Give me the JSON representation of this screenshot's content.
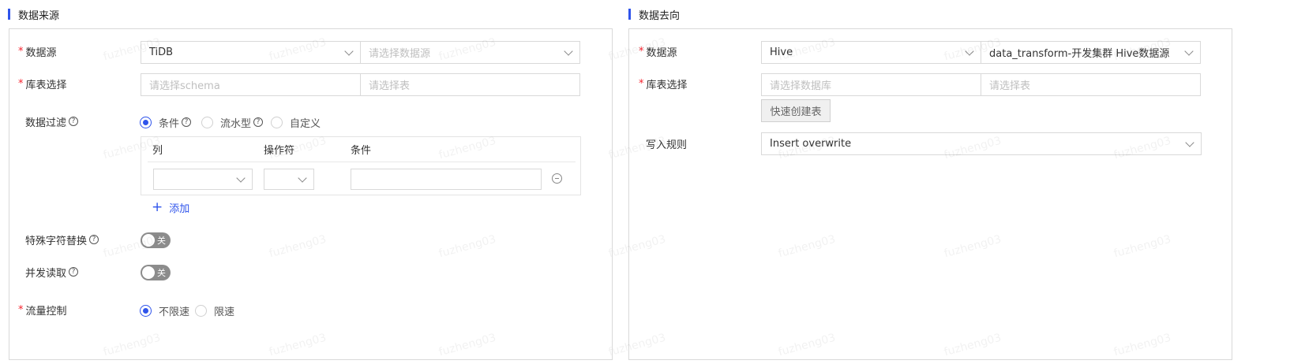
{
  "source": {
    "title": "数据来源",
    "datasource_label": "数据源",
    "datasource_type": "TiDB",
    "datasource_placeholder": "请选择数据源",
    "table_label": "库表选择",
    "schema_placeholder": "请选择schema",
    "table_placeholder": "请选择表",
    "filter_label": "数据过滤",
    "filter_options": [
      "条件",
      "流水型",
      "自定义"
    ],
    "filter_selected": "条件",
    "filter_columns": [
      "列",
      "操作符",
      "条件"
    ],
    "add_label": "添加",
    "special_char_label": "特殊字符替换",
    "special_char_toggle": "关",
    "concurrent_label": "并发读取",
    "concurrent_toggle": "关",
    "flow_label": "流量控制",
    "flow_options": [
      "不限速",
      "限速"
    ],
    "flow_selected": "不限速"
  },
  "target": {
    "title": "数据去向",
    "datasource_label": "数据源",
    "datasource_type": "Hive",
    "datasource_value": "data_transform-开发集群 Hive数据源",
    "table_label": "库表选择",
    "db_placeholder": "请选择数据库",
    "table_placeholder": "请选择表",
    "quick_create_label": "快速创建表",
    "write_rule_label": "写入规则",
    "write_rule_value": "Insert overwrite"
  },
  "watermark": "fuzheng03",
  "colors": {
    "accent": "#2f54eb",
    "required": "#f5222d",
    "toggle_off": "#8c8c8c"
  }
}
